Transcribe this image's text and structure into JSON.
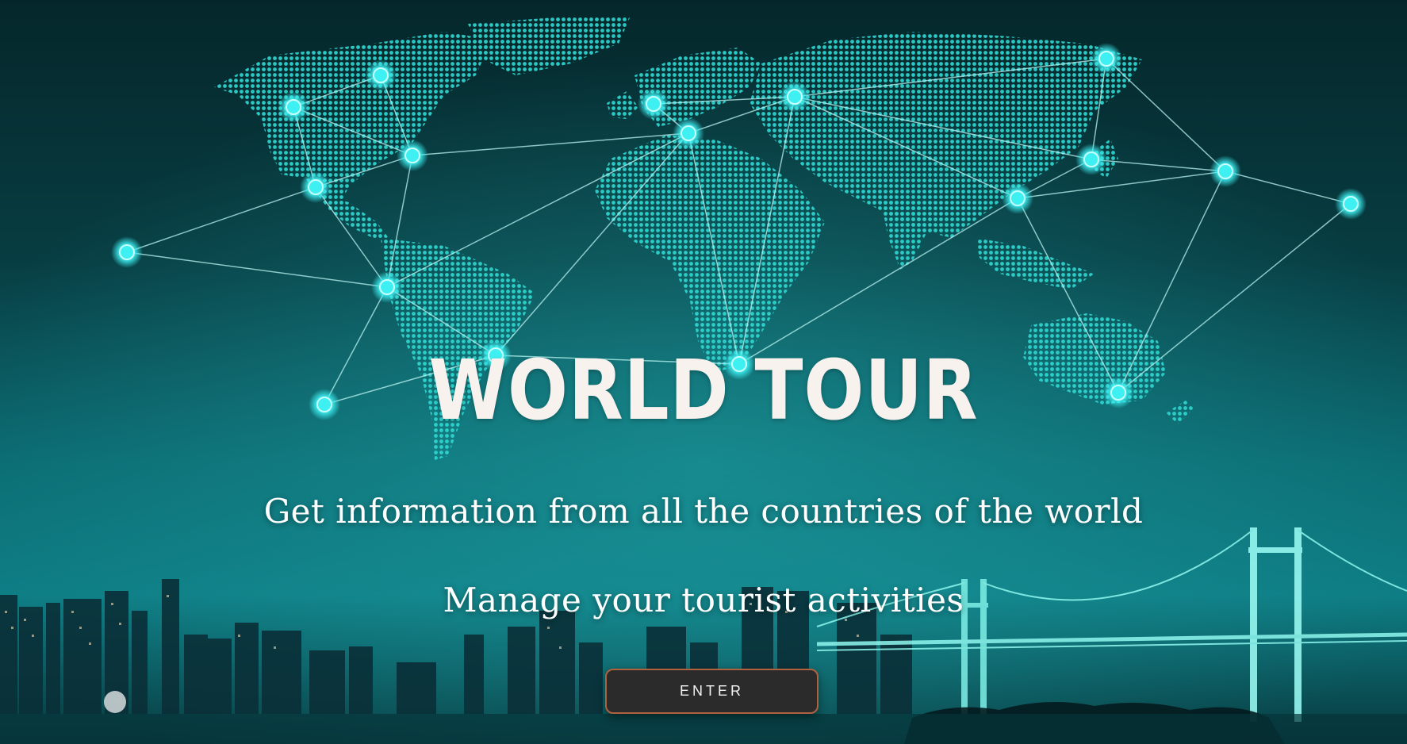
{
  "hero": {
    "title": "WORLD TOUR",
    "subtitle": "Get information from all the countries of the world",
    "tagline": "Manage your tourist activities",
    "enter_label": "ENTER"
  },
  "colors": {
    "background_top": "#062a2e",
    "background_bottom": "#0f7a80",
    "map_dots": "#2fd6d0",
    "node": "#3ef0f2",
    "title_text": "#f7f2ee",
    "button_bg": "#2b2b2b",
    "button_border": "#b0623e"
  },
  "background": {
    "map": "world-map-dotted",
    "skyline": "city-skyline-night",
    "bridge": "suspension-bridge"
  }
}
